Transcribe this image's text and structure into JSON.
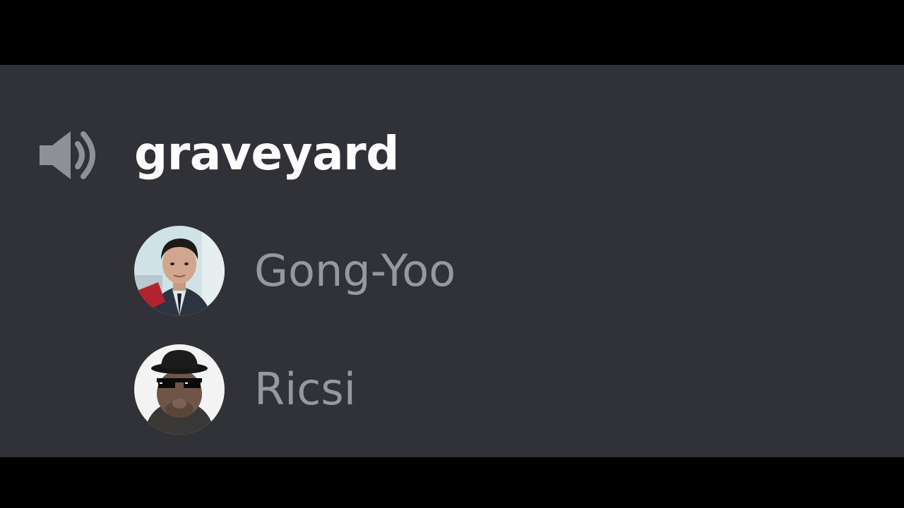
{
  "channel": {
    "name": "graveyard",
    "icon": "speaker-icon"
  },
  "users": [
    {
      "name": "Gong-Yoo",
      "avatar": "gong-yoo-avatar"
    },
    {
      "name": "Ricsi",
      "avatar": "ricsi-avatar"
    }
  ],
  "colors": {
    "background": "#313237",
    "channel_text": "#ffffff",
    "user_text": "#96989d",
    "icon": "#8e9297"
  }
}
